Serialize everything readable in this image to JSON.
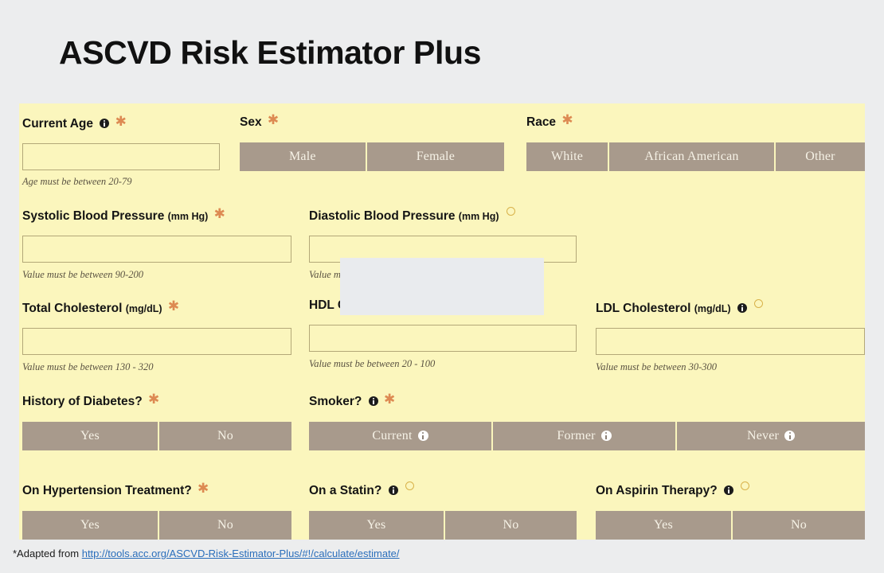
{
  "page": {
    "title": "ASCVD Risk Estimator Plus",
    "background_color": "#ecedee",
    "panel_color": "#fbf6bd",
    "button_color": "#a89a8c",
    "required_mark_color": "#dd8a52",
    "optional_mark_color": "#d8b24a",
    "link_color": "#2a6ebb"
  },
  "form": {
    "current_age": {
      "label": "Current Age",
      "value": "",
      "placeholder": "",
      "helper": "Age must be between 20-79",
      "required": true,
      "has_info": true
    },
    "sex": {
      "label": "Sex",
      "required": true,
      "options": [
        "Male",
        "Female"
      ]
    },
    "race": {
      "label": "Race",
      "required": true,
      "options": [
        "White",
        "African American",
        "Other"
      ]
    },
    "systolic_bp": {
      "label": "Systolic Blood Pressure",
      "unit": "(mm Hg)",
      "value": "",
      "placeholder": "",
      "helper": "Value must be between 90-200",
      "required": true
    },
    "diastolic_bp": {
      "label": "Diastolic Blood Pressure",
      "unit": "(mm Hg)",
      "value": "",
      "placeholder": "",
      "helper": "Value mu",
      "required": false
    },
    "total_cholesterol": {
      "label": "Total Cholesterol",
      "unit": "(mg/dL)",
      "value": "",
      "placeholder": "",
      "helper": "Value must be between 130 - 320",
      "required": true
    },
    "hdl_cholesterol": {
      "label": "HDL C",
      "unit": "",
      "value": "",
      "placeholder": "",
      "helper": "Value must be between 20 - 100",
      "required": false
    },
    "ldl_cholesterol": {
      "label": "LDL Cholesterol",
      "unit": "(mg/dL)",
      "value": "",
      "placeholder": "",
      "helper": "Value must be between 30-300",
      "required": false,
      "has_info": true
    },
    "diabetes": {
      "label": "History of Diabetes?",
      "required": true,
      "options": [
        "Yes",
        "No"
      ]
    },
    "smoker": {
      "label": "Smoker?",
      "required": true,
      "has_info": true,
      "options": [
        "Current",
        "Former",
        "Never"
      ]
    },
    "hypertension_treatment": {
      "label": "On Hypertension Treatment?",
      "required": true,
      "options": [
        "Yes",
        "No"
      ]
    },
    "statin": {
      "label": "On a Statin?",
      "required": false,
      "has_info": true,
      "options": [
        "Yes",
        "No"
      ]
    },
    "aspirin": {
      "label": "On Aspirin Therapy?",
      "required": false,
      "has_info": true,
      "options": [
        "Yes",
        "No"
      ]
    }
  },
  "footer": {
    "prefix": "*Adapted from ",
    "link_text": "http://tools.acc.org/ASCVD-Risk-Estimator-Plus/#!/calculate/estimate/"
  }
}
